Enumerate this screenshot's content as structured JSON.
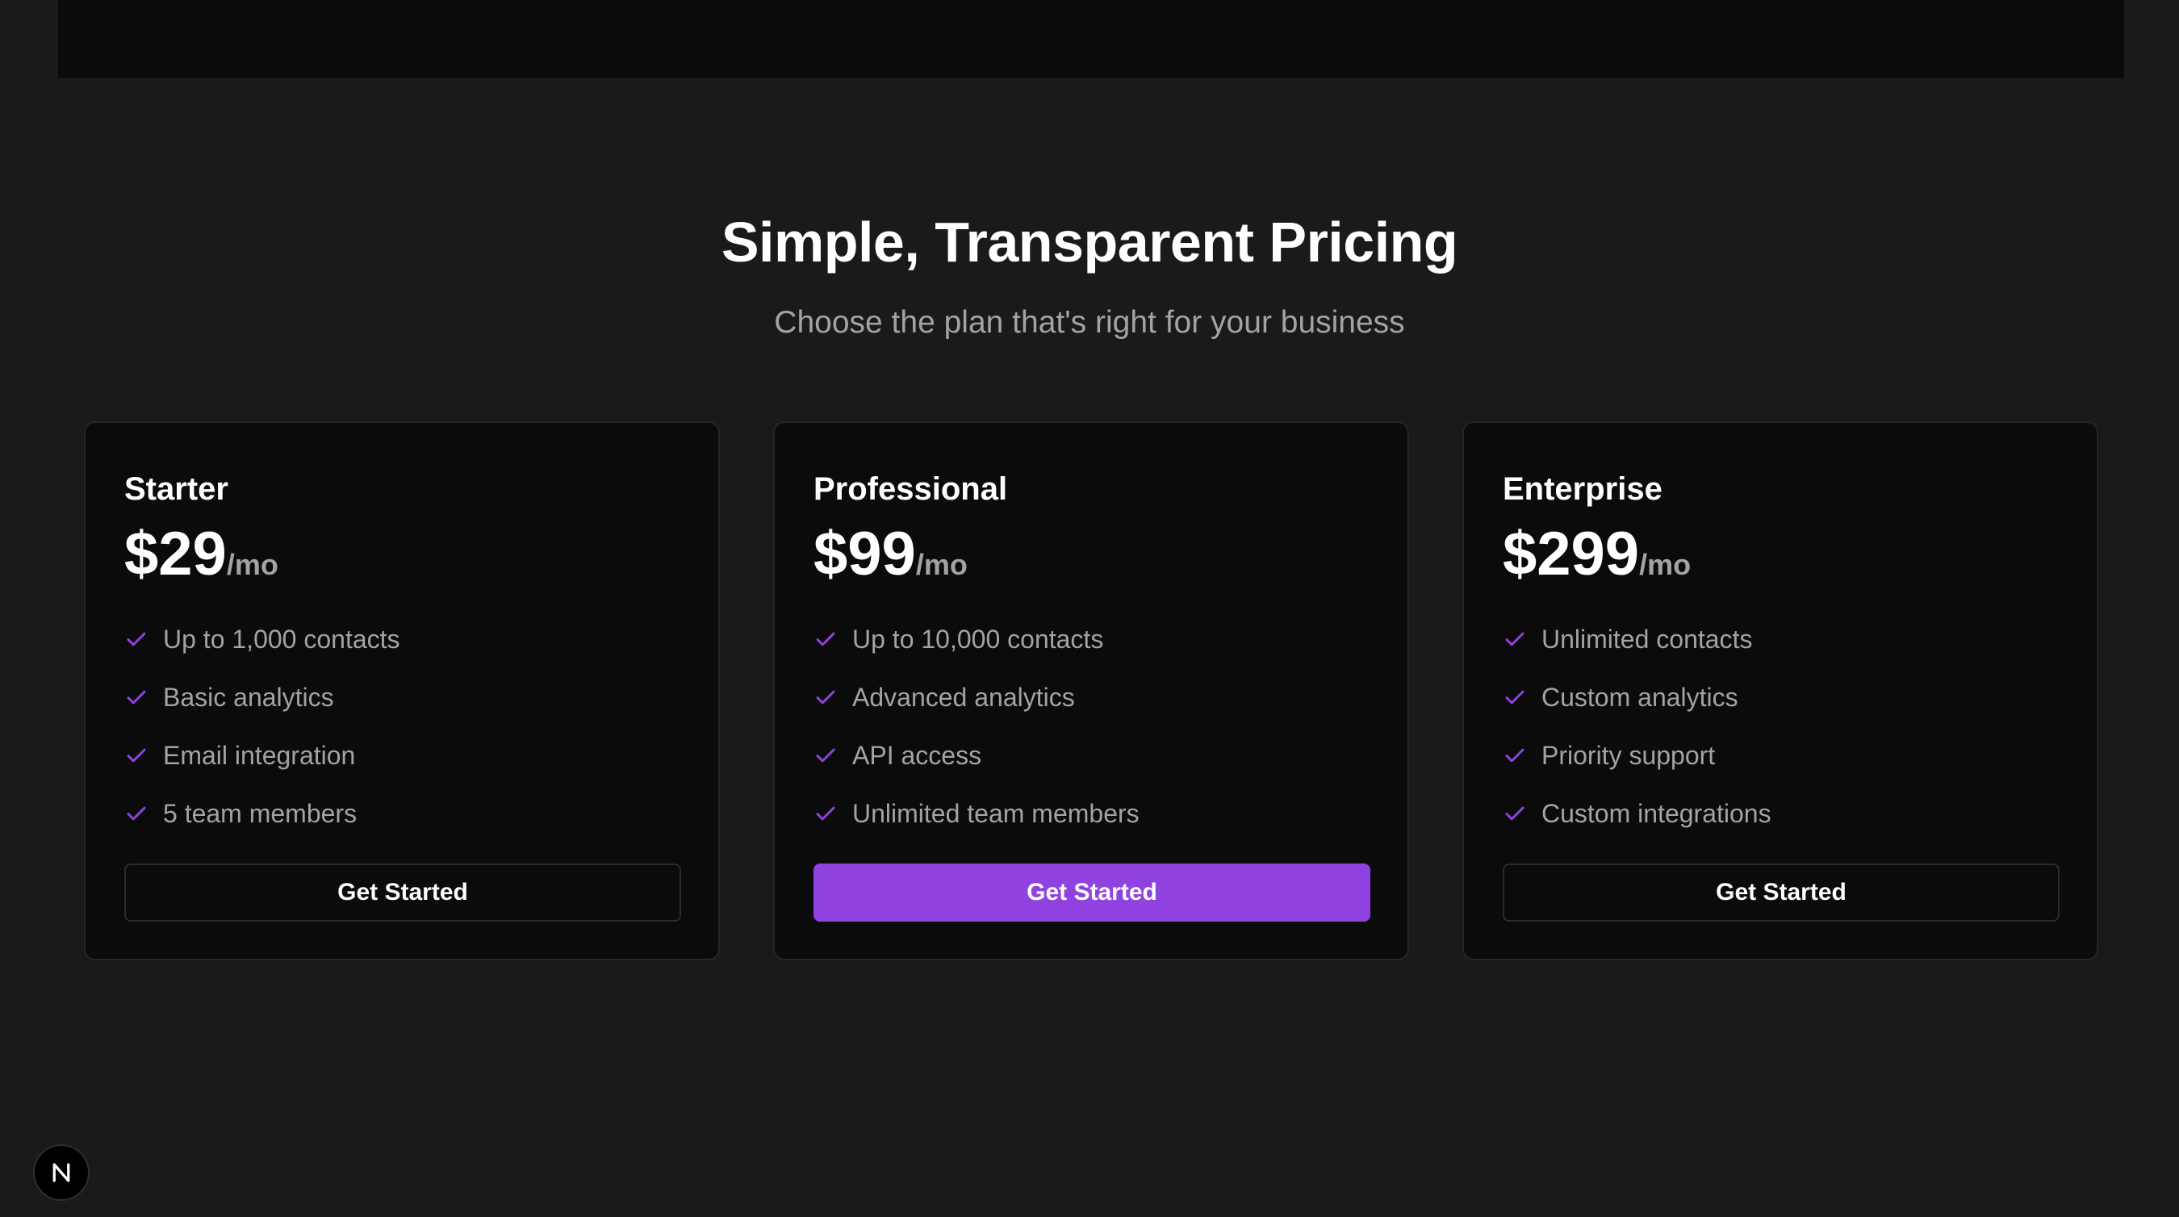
{
  "pricing": {
    "title": "Simple, Transparent Pricing",
    "subtitle": "Choose the plan that's right for your business",
    "accent_color": "#9042e0",
    "plans": [
      {
        "name": "Starter",
        "price": "$29",
        "period": "/mo",
        "features": [
          "Up to 1,000 contacts",
          "Basic analytics",
          "Email integration",
          "5 team members"
        ],
        "cta_label": "Get Started",
        "highlighted": false
      },
      {
        "name": "Professional",
        "price": "$99",
        "period": "/mo",
        "features": [
          "Up to 10,000 contacts",
          "Advanced analytics",
          "API access",
          "Unlimited team members"
        ],
        "cta_label": "Get Started",
        "highlighted": true
      },
      {
        "name": "Enterprise",
        "price": "$299",
        "period": "/mo",
        "features": [
          "Unlimited contacts",
          "Custom analytics",
          "Priority support",
          "Custom integrations"
        ],
        "cta_label": "Get Started",
        "highlighted": false
      }
    ]
  },
  "icons": {
    "feature_icon": "check-icon",
    "badge_icon": "n-logo-icon"
  }
}
